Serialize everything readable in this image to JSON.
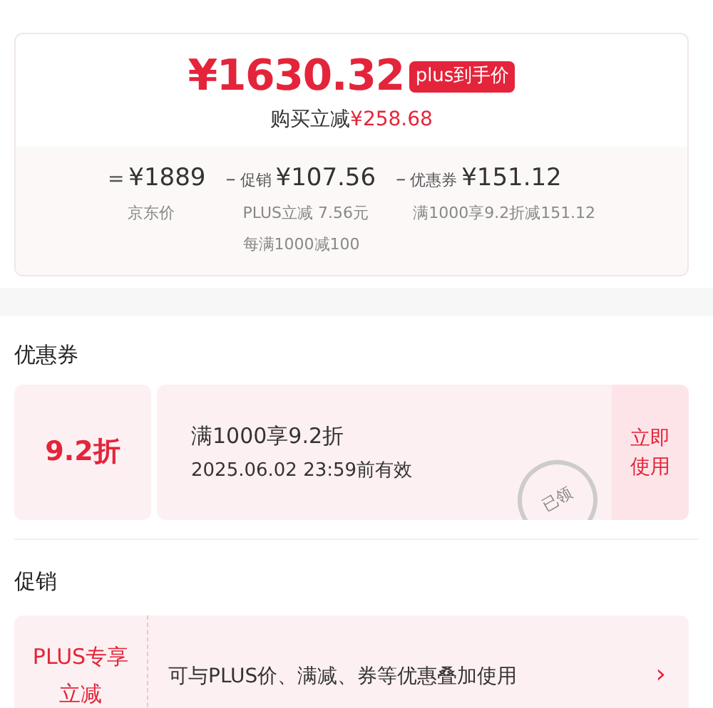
{
  "summary": {
    "price": "¥1630.32",
    "price_tag": "plus到手价",
    "saving_label": "购买立减",
    "saving": "¥258.68",
    "terms": [
      {
        "operator": "=",
        "amount": "¥1889",
        "notes": [
          "京东价"
        ]
      },
      {
        "operator": "–",
        "label": "促销",
        "amount": "¥107.56",
        "notes": [
          "PLUS立减 7.56元",
          "每满1000减100"
        ]
      },
      {
        "operator": "–",
        "label": "优惠券",
        "amount": "¥151.12",
        "notes": [
          "满1000享9.2折减151.12"
        ]
      }
    ]
  },
  "coupon_section": {
    "title": "优惠券",
    "coupons": [
      {
        "discount": "9.2折",
        "condition": "满1000享9.2折",
        "validity": "2025.06.02 23:59前有效",
        "stamp": "已领",
        "action": "立即使用"
      }
    ]
  },
  "promo_section": {
    "title": "促销",
    "promos": [
      {
        "tag": "PLUS专享立减",
        "description": "可与PLUS价、满减、券等优惠叠加使用",
        "chevron": "›"
      }
    ]
  }
}
